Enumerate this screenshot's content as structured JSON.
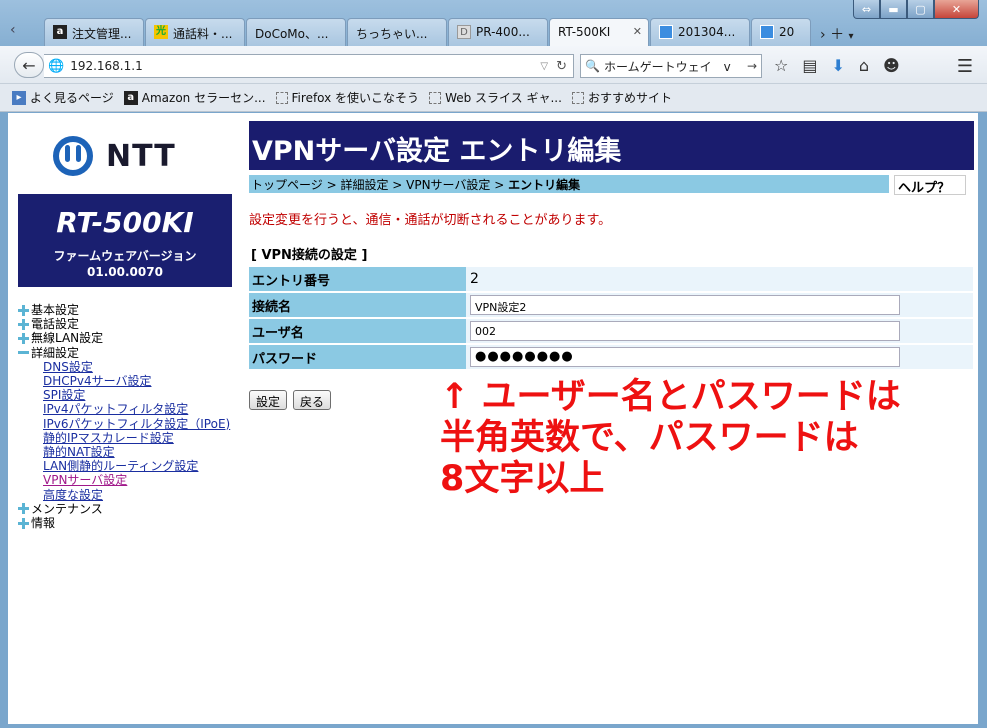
{
  "browser": {
    "tabs": [
      {
        "label": "注文管理...",
        "icon": "amazon-icon"
      },
      {
        "label": "通話料・...",
        "icon": "hikari-icon"
      },
      {
        "label": "DoCoMo、...",
        "icon": ""
      },
      {
        "label": "ちっちゃい...",
        "icon": ""
      },
      {
        "label": "PR-400...",
        "icon": "doc-icon"
      },
      {
        "label": "RT-500KI",
        "icon": "",
        "active": true
      },
      {
        "label": "201304...",
        "icon": "page-icon"
      },
      {
        "label": "20",
        "icon": "page-icon"
      }
    ],
    "url": "192.168.1.1",
    "search_text": "ホームゲートウェイ　v",
    "bookmarks": [
      {
        "label": "よく見るページ",
        "icon": "bookmark-icon"
      },
      {
        "label": "Amazon セラーセン...",
        "icon": "amazon-icon"
      },
      {
        "label": "Firefox を使いこなそう",
        "icon": "box"
      },
      {
        "label": "Web スライス ギャ...",
        "icon": "box"
      },
      {
        "label": "おすすめサイト",
        "icon": "box"
      }
    ]
  },
  "sidebar": {
    "logo_text": "NTT",
    "model": "RT-500KI",
    "firmware_label": "ファームウェアバージョン",
    "firmware_version": "01.00.0070",
    "menu": [
      {
        "label": "基本設定",
        "type": "plus"
      },
      {
        "label": "電話設定",
        "type": "plus"
      },
      {
        "label": "無線LAN設定",
        "type": "plus"
      },
      {
        "label": "詳細設定",
        "type": "minus"
      }
    ],
    "submenu": [
      "DNS設定",
      "DHCPv4サーバ設定",
      "SPI設定",
      "IPv4パケットフィルタ設定",
      "IPv6パケットフィルタ設定（IPoE)",
      "静的IPマスカレード設定",
      "静的NAT設定",
      "LAN側静的ルーティング設定",
      "VPNサーバ設定",
      "高度な設定"
    ],
    "menu_after": [
      {
        "label": "メンテナンス",
        "type": "plus"
      },
      {
        "label": "情報",
        "type": "plus"
      }
    ]
  },
  "main": {
    "title": "VPNサーバ設定 エントリ編集",
    "breadcrumb": {
      "prefix": "トップページ > 詳細設定 > VPNサーバ設定 > ",
      "current": "エントリ編集"
    },
    "help": "ヘルプ？",
    "warning": "設定変更を行うと、通信・通話が切断されることがあります。",
    "section": "[ VPN接続の設定 ]",
    "fields": {
      "entry_label": "エントリ番号",
      "entry_value": "2",
      "name_label": "接続名",
      "name_value": "VPN設定2",
      "user_label": "ユーザ名",
      "user_value": "002",
      "pw_label": "パスワード",
      "pw_value": "●●●●●●●●"
    },
    "buttons": {
      "set": "設定",
      "back": "戻る"
    }
  },
  "annotation": {
    "lines": [
      "↑ ユーザー名とパスワードは",
      "半角英数で、パスワードは",
      "8文字以上"
    ],
    "color": "#ee1111"
  }
}
